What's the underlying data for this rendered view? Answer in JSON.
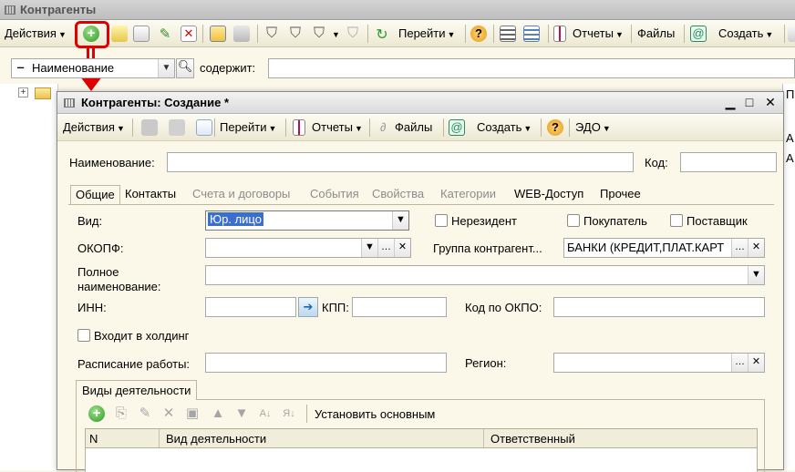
{
  "back_window": {
    "title": "Контрагенты",
    "toolbar": {
      "actions": "Действия",
      "goto": "Перейти",
      "reports": "Отчеты",
      "files": "Файлы",
      "create": "Создать"
    },
    "filter": {
      "field": "Наименование",
      "mode_label": "содержит:",
      "value": ""
    },
    "right_column": [
      "П",
      "А",
      "А"
    ]
  },
  "window": {
    "title": "Контрагенты: Создание *",
    "toolbar": {
      "actions": "Действия",
      "goto": "Перейти",
      "reports": "Отчеты",
      "files": "Файлы",
      "create": "Создать",
      "edo": "ЭДО"
    },
    "name_label": "Наименование:",
    "name_value": "",
    "code_label": "Код:",
    "code_value": ""
  },
  "tabs": [
    {
      "label": "Общие",
      "active": true,
      "enabled": true
    },
    {
      "label": "Контакты",
      "active": false,
      "enabled": true
    },
    {
      "label": "Счета и договоры",
      "active": false,
      "enabled": false
    },
    {
      "label": "События",
      "active": false,
      "enabled": false
    },
    {
      "label": "Свойства",
      "active": false,
      "enabled": false
    },
    {
      "label": "Категории",
      "active": false,
      "enabled": false
    },
    {
      "label": "WEB-Доступ",
      "active": false,
      "enabled": true
    },
    {
      "label": "Прочее",
      "active": false,
      "enabled": true
    }
  ],
  "form": {
    "vid_label": "Вид:",
    "vid_value": "Юр. лицо",
    "nonresident": "Нерезидент",
    "buyer": "Покупатель",
    "supplier": "Поставщик",
    "okopf_label": "ОКОПФ:",
    "okopf_value": "",
    "group_label": "Группа контрагент...",
    "group_value": "БАНКИ (КРЕДИТ,ПЛАТ.КАРТ",
    "fullname_label_1": "Полное",
    "fullname_label_2": "наименование:",
    "fullname_value": "",
    "inn_label": "ИНН:",
    "inn_value": "",
    "kpp_label": "КПП:",
    "kpp_value": "",
    "okpo_label": "Код по ОКПО:",
    "okpo_value": "",
    "holding_label": "Входит в холдинг",
    "schedule_label": "Расписание работы:",
    "schedule_value": "",
    "region_label": "Регион:",
    "region_value": ""
  },
  "activities": {
    "group_title": "Виды деятельности",
    "set_main": "Установить основным",
    "columns": [
      "N",
      "Вид деятельности",
      "Ответственный"
    ]
  },
  "colors": {
    "highlight": "#e00000",
    "selection": "#3a6fd0",
    "panel": "#fbf8e9"
  }
}
